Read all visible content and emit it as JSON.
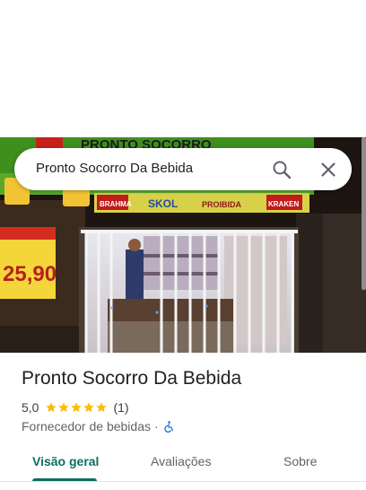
{
  "search": {
    "query": "Pronto Socorro Da Bebida",
    "search_icon": "search-icon",
    "close_icon": "close-icon"
  },
  "photo": {
    "sign_top": "PRONTO SOCORRO",
    "banner_brands": [
      "BRAHMA",
      "SKOL",
      "PROIBIDA",
      "KRAKEN"
    ],
    "price_sign": "25,90"
  },
  "place": {
    "name": "Pronto Socorro Da Bebida",
    "rating": "5,0",
    "stars": 5,
    "review_count": "(1)",
    "category": "Fornecedor de bebidas",
    "separator": "·",
    "accessibility_icon": "wheelchair-accessible-icon"
  },
  "tabs": [
    {
      "label": "Visão geral",
      "active": true
    },
    {
      "label": "Avaliações",
      "active": false
    },
    {
      "label": "Sobre",
      "active": false
    }
  ],
  "colors": {
    "accent": "#0b6e63",
    "star": "#fbbc04",
    "title": "#202124",
    "secondary": "#5f6368"
  }
}
